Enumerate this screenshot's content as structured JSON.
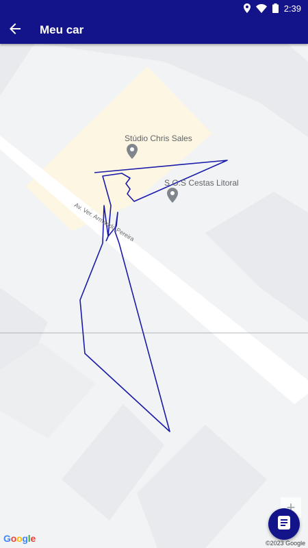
{
  "status_bar": {
    "time": "2:39",
    "icons": [
      "location-icon",
      "wifi-icon",
      "battery-icon"
    ]
  },
  "app_bar": {
    "title": "Meu car",
    "back_icon": "arrow-back-icon"
  },
  "map": {
    "pois": [
      {
        "name": "Stúdio Chris Sales"
      },
      {
        "name": "S.O.S Cestas Litoral"
      }
    ],
    "street": "Av. Ver. Armando Pereira",
    "route_color": "#1a1aa8",
    "copyright": "©2023 Google",
    "logo": "Google"
  },
  "controls": {
    "zoom_in_label": "+",
    "fab_icon": "list-document-icon"
  },
  "colors": {
    "app_bar": "#14148a",
    "highlight_area": "#fdf6e3",
    "poi_pin": "#80868b"
  }
}
